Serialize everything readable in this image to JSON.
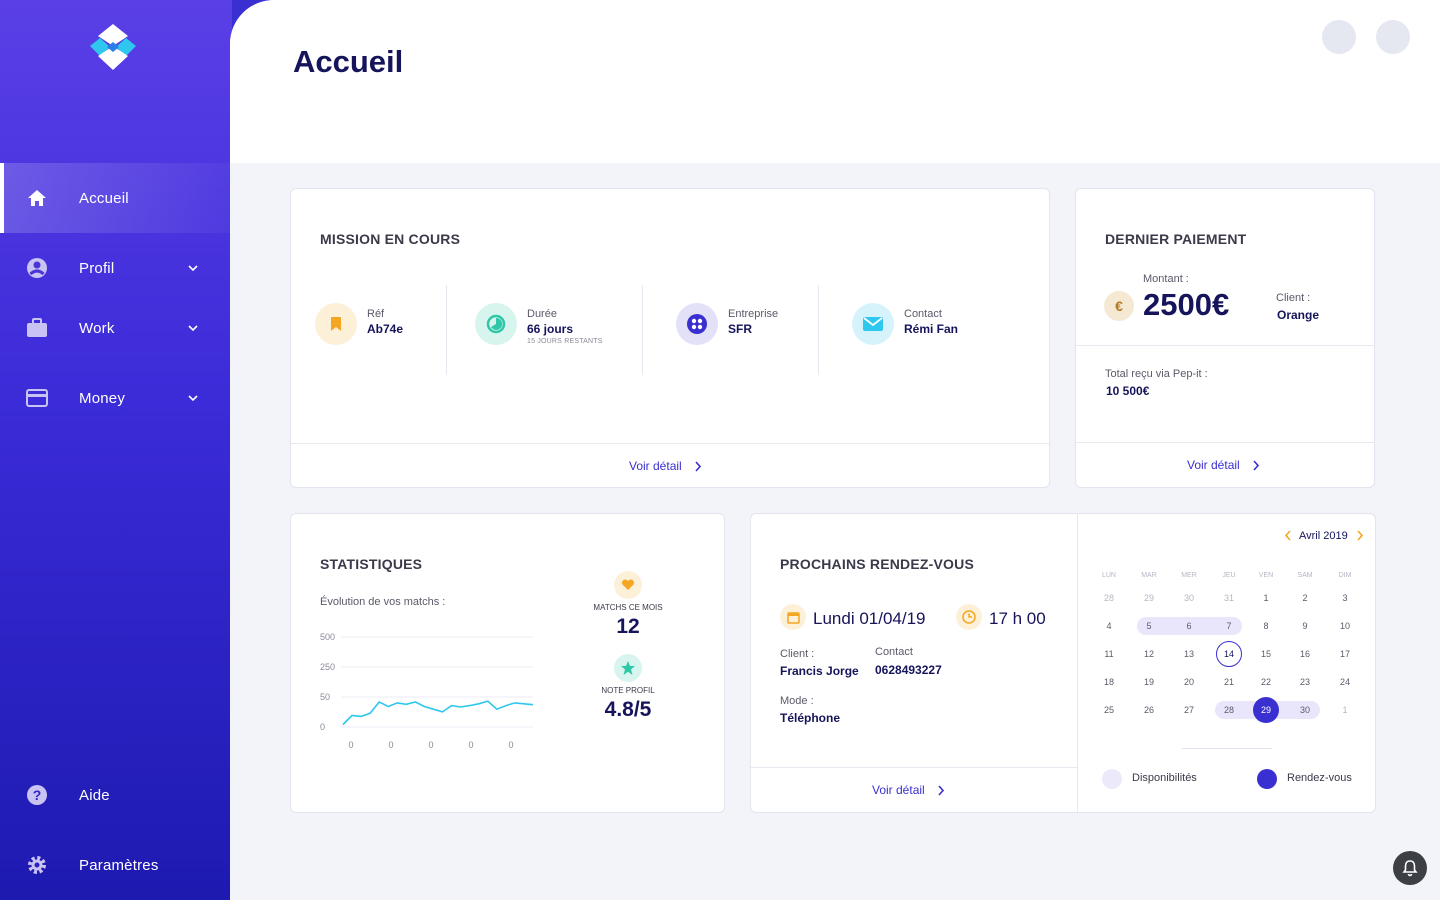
{
  "nav": {
    "items": [
      {
        "label": "Accueil",
        "icon": "home-icon"
      },
      {
        "label": "Profil",
        "icon": "user-icon"
      },
      {
        "label": "Work",
        "icon": "briefcase-icon"
      },
      {
        "label": "Money",
        "icon": "credit-card-icon"
      }
    ],
    "bottom": [
      {
        "label": "Aide",
        "icon": "help-icon"
      },
      {
        "label": "Paramètres",
        "icon": "gear-icon"
      }
    ]
  },
  "header": {
    "title": "Accueil"
  },
  "mission": {
    "title": "MISSION EN COURS",
    "ref_label": "Réf",
    "ref_value": "Ab74e",
    "duree_label": "Durée",
    "duree_value": "66 jours",
    "duree_sub": "15 JOURS RESTANTS",
    "entreprise_label": "Entreprise",
    "entreprise_value": "SFR",
    "contact_label": "Contact",
    "contact_value": "Rémi Fan",
    "link": "Voir détail"
  },
  "paiement": {
    "title": "DERNIER PAIEMENT",
    "montant_label": "Montant :",
    "montant_value": "2500€",
    "currency_symbol": "€",
    "client_label": "Client :",
    "client_value": "Orange",
    "total_label": "Total reçu via Pep-it :",
    "total_value": "10 500€",
    "link": "Voir détail"
  },
  "stats": {
    "title": "STATISTIQUES",
    "subtitle": "Évolution de vos matchs :",
    "matchs_label": "MATCHS CE MOIS",
    "matchs_value": "12",
    "note_label": "NOTE PROFIL",
    "note_value": "4.8/5",
    "chart_data": {
      "type": "line",
      "y_tick_labels": [
        "500",
        "250",
        "50",
        "0"
      ],
      "x_tick_labels": [
        "0",
        "0",
        "0",
        "0",
        "0"
      ],
      "values": [
        10,
        30,
        28,
        35,
        60,
        50,
        58,
        55,
        60,
        50,
        44,
        38,
        52,
        49,
        52,
        56,
        62,
        44,
        52,
        58,
        56,
        54
      ],
      "color": "#2ec7ee",
      "grid": true
    }
  },
  "rdv": {
    "title": "PROCHAINS RENDEZ-VOUS",
    "date": "Lundi 01/04/19",
    "time": "17 h 00",
    "client_label": "Client :",
    "client_value": "Francis Jorge",
    "contact_label": "Contact",
    "contact_value": "0628493227",
    "mode_label": "Mode :",
    "mode_value": "Téléphone",
    "link": "Voir détail"
  },
  "calendar": {
    "month": "Avril 2019",
    "weekdays": [
      "LUN",
      "MAR",
      "MER",
      "JEU",
      "VEN",
      "SAM",
      "DIM"
    ],
    "weeks": [
      [
        "28",
        "29",
        "30",
        "31",
        "1",
        "2",
        "3"
      ],
      [
        "4",
        "5",
        "6",
        "7",
        "8",
        "9",
        "10"
      ],
      [
        "11",
        "12",
        "13",
        "14",
        "15",
        "16",
        "17"
      ],
      [
        "18",
        "19",
        "20",
        "21",
        "22",
        "23",
        "24"
      ],
      [
        "25",
        "26",
        "27",
        "28",
        "29",
        "30",
        "1"
      ]
    ],
    "today": "14",
    "selected": "29",
    "legend_avail": "Disponibilités",
    "legend_rdv": "Rendez-vous",
    "accent": "#3a2fd0",
    "arrow_color": "#f5a623"
  }
}
